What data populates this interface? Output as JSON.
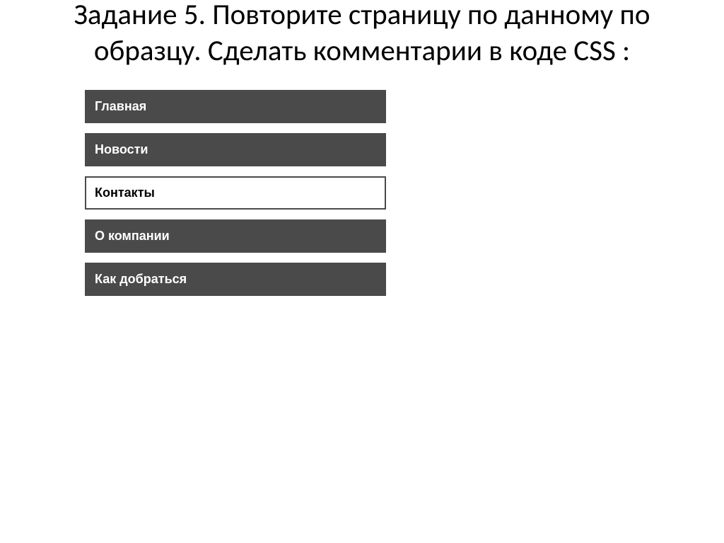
{
  "heading": "Задание 5. Повторите страницу по данному по образцу. Сделать комментарии в коде CSS :",
  "menu": {
    "items": [
      {
        "label": "Главная",
        "active": false
      },
      {
        "label": "Новости",
        "active": false
      },
      {
        "label": "Контакты",
        "active": true
      },
      {
        "label": "О компании",
        "active": false
      },
      {
        "label": "Как добраться",
        "active": false
      }
    ]
  }
}
